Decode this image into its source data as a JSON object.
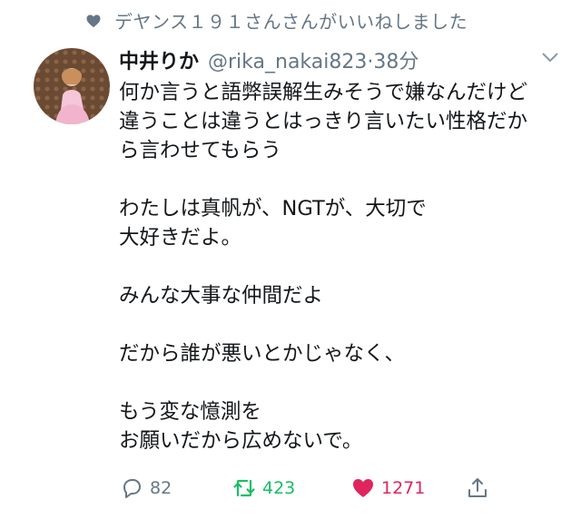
{
  "context": {
    "text": "デヤンス１９１さんさんがいいねしました"
  },
  "tweet": {
    "name": "中井りか",
    "handle": "@rika_nakai823",
    "separator": "·",
    "time": "38分",
    "lines": [
      "何か言うと語弊誤解生みそうで嫌なんだけど",
      "違うことは違うとはっきり言いたい性格だか",
      "ら言わせてもらう",
      "",
      "わたしは真帆が、NGTが、大切で",
      "大好きだよ。",
      "",
      "みんな大事な仲間だよ",
      "",
      "だから誰が悪いとかじゃなく、",
      "",
      "もう変な憶測を",
      "お願いだから広めないで。"
    ]
  },
  "actions": {
    "reply_count": "82",
    "retweet_count": "423",
    "like_count": "1271"
  },
  "colors": {
    "text": "#14171a",
    "muted": "#657786",
    "retweet": "#17bf63",
    "like": "#e0245e"
  },
  "icons": [
    "heart-icon",
    "chevron-down-icon",
    "reply-icon",
    "retweet-icon",
    "like-icon",
    "share-icon"
  ]
}
